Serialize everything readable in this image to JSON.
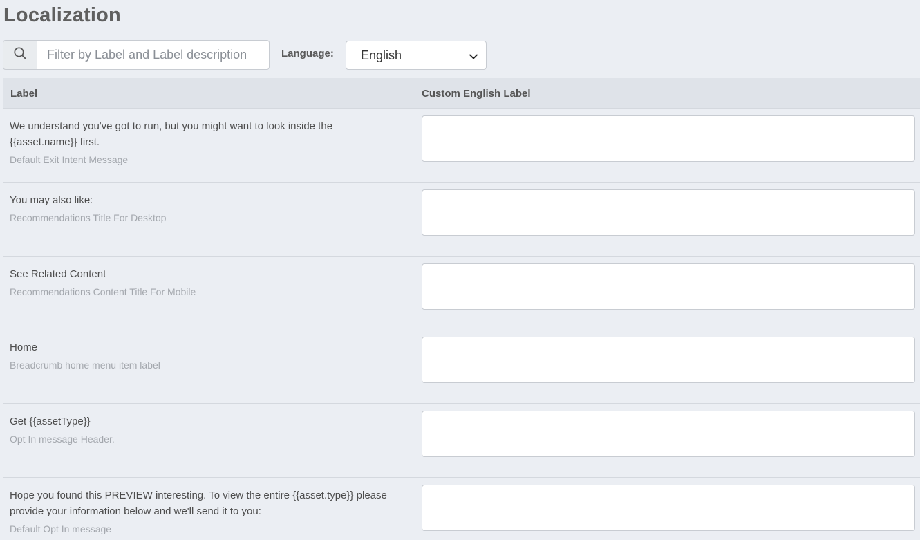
{
  "page": {
    "title": "Localization"
  },
  "filter": {
    "placeholder": "Filter by Label and Label description",
    "value": ""
  },
  "language": {
    "label": "Language:",
    "selected": "English"
  },
  "table": {
    "headers": {
      "label": "Label",
      "custom": "Custom English Label"
    },
    "rows": [
      {
        "label": "We understand you've got to run, but you might want to look inside the {{asset.name}} first.",
        "description": "Default Exit Intent Message",
        "custom": ""
      },
      {
        "label": "You may also like:",
        "description": "Recommendations Title For Desktop",
        "custom": ""
      },
      {
        "label": "See Related Content",
        "description": "Recommendations Content Title For Mobile",
        "custom": ""
      },
      {
        "label": "Home",
        "description": "Breadcrumb home menu item label",
        "custom": ""
      },
      {
        "label": "Get {{assetType}}",
        "description": "Opt In message Header.",
        "custom": ""
      },
      {
        "label": "Hope you found this PREVIEW interesting. To view the entire {{asset.type}} please provide your information below and we'll send it to you:",
        "description": "Default Opt In message",
        "custom": ""
      }
    ]
  },
  "icons": {
    "search": "search-icon",
    "select_arrow": "chevron-down-icon"
  }
}
